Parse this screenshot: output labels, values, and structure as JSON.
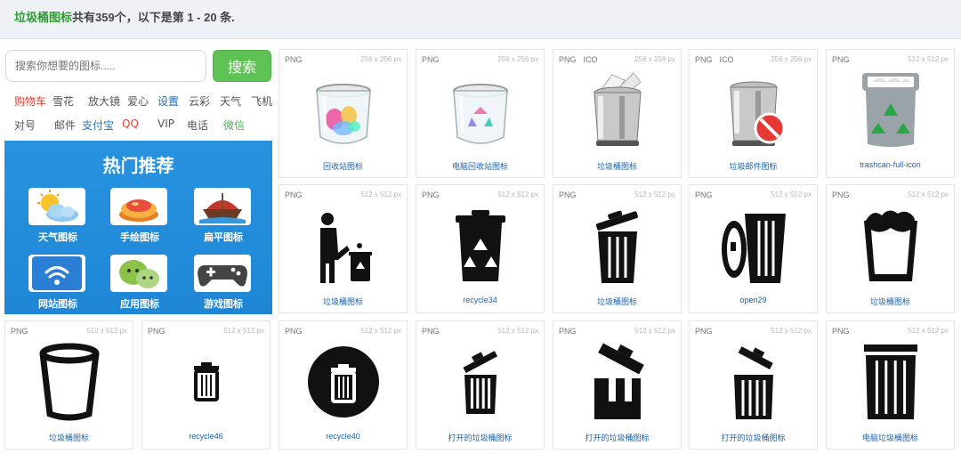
{
  "summary": {
    "keyword": "垃圾桶图标",
    "text": "共有359个，以下是第 1 - 20 条."
  },
  "search": {
    "placeholder": "搜索你想要的图标.....",
    "button": "搜索"
  },
  "tags_row1": [
    {
      "label": "购物车",
      "color": "#e0483b"
    },
    {
      "label": "雪花",
      "color": "#555555"
    },
    {
      "label": "放大镜",
      "color": "#555555"
    },
    {
      "label": "爱心",
      "color": "#555555"
    },
    {
      "label": "设置",
      "color": "#1f6fc3"
    },
    {
      "label": "云彩",
      "color": "#555555"
    },
    {
      "label": "天气",
      "color": "#555555"
    },
    {
      "label": "飞机",
      "color": "#555555"
    }
  ],
  "tags_row2": [
    {
      "label": "对号",
      "color": "#555555"
    },
    {
      "label": "邮件",
      "color": "#555555"
    },
    {
      "label": "支付宝",
      "color": "#1f6fc3"
    },
    {
      "label": "QQ",
      "color": "#e0483b"
    },
    {
      "label": "VIP",
      "color": "#555555"
    },
    {
      "label": "电话",
      "color": "#555555"
    },
    {
      "label": "微信",
      "color": "#4caf50"
    }
  ],
  "hot": {
    "title": "热门推荐",
    "items": [
      {
        "label": "天气图标",
        "icon": "weather-icon"
      },
      {
        "label": "手绘图标",
        "icon": "hand-drawn-icon"
      },
      {
        "label": "扁平图标",
        "icon": "flat-icon"
      },
      {
        "label": "网站图标",
        "icon": "website-icon"
      },
      {
        "label": "应用图标",
        "icon": "app-icon"
      },
      {
        "label": "游戏图标",
        "icon": "game-icon"
      }
    ]
  },
  "icons": [
    {
      "formats": [
        "PNG"
      ],
      "size": "256 x 256 px",
      "name": "回收站图标",
      "icon": "glass-recycle-bin-icon"
    },
    {
      "formats": [
        "PNG"
      ],
      "size": "256 x 256 px",
      "name": "电脑回收站图标",
      "icon": "glass-recycle-bin-empty-icon"
    },
    {
      "formats": [
        "PNG",
        "ICO"
      ],
      "size": "256 x 256 px",
      "name": "垃圾桶图标",
      "icon": "pedal-bin-full-icon"
    },
    {
      "formats": [
        "PNG",
        "ICO"
      ],
      "size": "256 x 256 px",
      "name": "垃圾邮件图标",
      "icon": "pedal-bin-blocked-icon"
    },
    {
      "formats": [
        "PNG"
      ],
      "size": "512 x 512 px",
      "name": "trashcan-full-icon",
      "icon": "recycle-bin-full-icon"
    },
    {
      "formats": [
        "PNG"
      ],
      "size": "512 x 512 px",
      "name": "垃圾桶图标",
      "icon": "person-disposing-trash-icon"
    },
    {
      "formats": [
        "PNG"
      ],
      "size": "512 x 512 px",
      "name": "recycle34",
      "icon": "recycle-bin-icon"
    },
    {
      "formats": [
        "PNG"
      ],
      "size": "512 x 512 px",
      "name": "垃圾桶图标",
      "icon": "trash-open-lid-icon"
    },
    {
      "formats": [
        "PNG"
      ],
      "size": "512 x 512 px",
      "name": "open29",
      "icon": "trash-lid-beside-icon"
    },
    {
      "formats": [
        "PNG"
      ],
      "size": "512 x 512 px",
      "name": "垃圾桶图标",
      "icon": "bucket-full-icon"
    },
    {
      "formats": [
        "PNG"
      ],
      "size": "512 x 512 px",
      "name": "垃圾桶图标",
      "icon": "bucket-outline-icon"
    },
    {
      "formats": [
        "PNG"
      ],
      "size": "512 x 512 px",
      "name": "recycle46",
      "icon": "small-trash-icon"
    },
    {
      "formats": [
        "PNG"
      ],
      "size": "512 x 512 px",
      "name": "recycle40",
      "icon": "trash-circle-icon"
    },
    {
      "formats": [
        "PNG"
      ],
      "size": "512 x 512 px",
      "name": "打开的垃圾桶图标",
      "icon": "trash-tilted-lid-icon"
    },
    {
      "formats": [
        "PNG"
      ],
      "size": "512 x 512 px",
      "name": "打开的垃圾桶图标",
      "icon": "trash-open-box-icon"
    },
    {
      "formats": [
        "PNG"
      ],
      "size": "512 x 512 px",
      "name": "打开的垃圾桶图标",
      "icon": "trash-flipped-lid-icon"
    },
    {
      "formats": [
        "PNG"
      ],
      "size": "512 x 512 px",
      "name": "电脑垃圾桶图标",
      "icon": "trash-tall-icon"
    }
  ]
}
